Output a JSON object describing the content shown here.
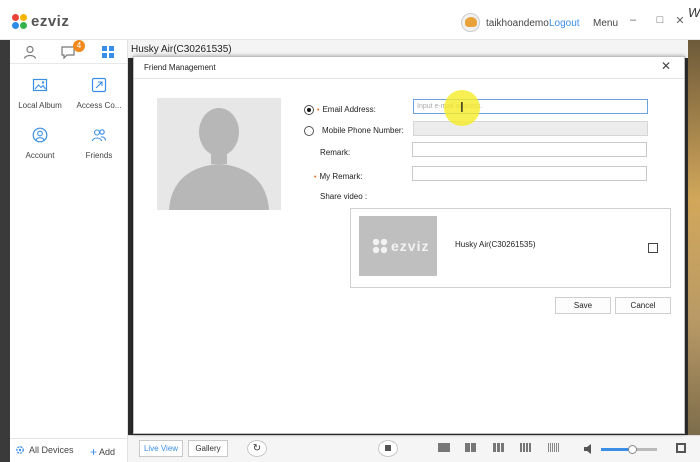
{
  "app": {
    "logo_text": "ezviz",
    "username": "taikhoandemo",
    "logout_label": "Logout",
    "menu_label": "Menu",
    "minimize_glyph": "–",
    "maximize_glyph": "□",
    "close_glyph": "✕",
    "corner_char": "W"
  },
  "sidebar": {
    "tabs": [
      {
        "icon": "person-icon"
      },
      {
        "icon": "chat-icon",
        "badge": "4"
      },
      {
        "icon": "grid-icon",
        "active": true
      }
    ],
    "tiles": [
      {
        "label": "Local Album",
        "icon": "image-icon"
      },
      {
        "label": "Access Co...",
        "icon": "access-control-icon"
      },
      {
        "label": "Account",
        "icon": "account-icon"
      },
      {
        "label": "Friends",
        "icon": "friends-icon"
      }
    ],
    "footer": {
      "all_devices_label": "All Devices",
      "add_label": "Add"
    }
  },
  "device_header": {
    "name": "Husky Air(C30261535)"
  },
  "dialog": {
    "title": "Friend Management",
    "email_label": "Email Address:",
    "email_placeholder": "Input e-mail address.",
    "phone_label": "Mobile Phone Number:",
    "remark_label": "Remark:",
    "my_remark_label": "My Remark:",
    "share_video_label": "Share video :",
    "share_device_name": "Husky Air(C30261535)",
    "share_logo_text": "ezviz",
    "save_label": "Save",
    "cancel_label": "Cancel",
    "selected_contact_type": "email"
  },
  "bottombar": {
    "live_view_label": "Live View",
    "gallery_label": "Gallery",
    "volume_level": 0.55
  },
  "colors": {
    "accent": "#3b8ee8",
    "badge": "#f08a1c",
    "required_marker": "#e46d1e",
    "cursor_highlight": "#f6ec28"
  }
}
